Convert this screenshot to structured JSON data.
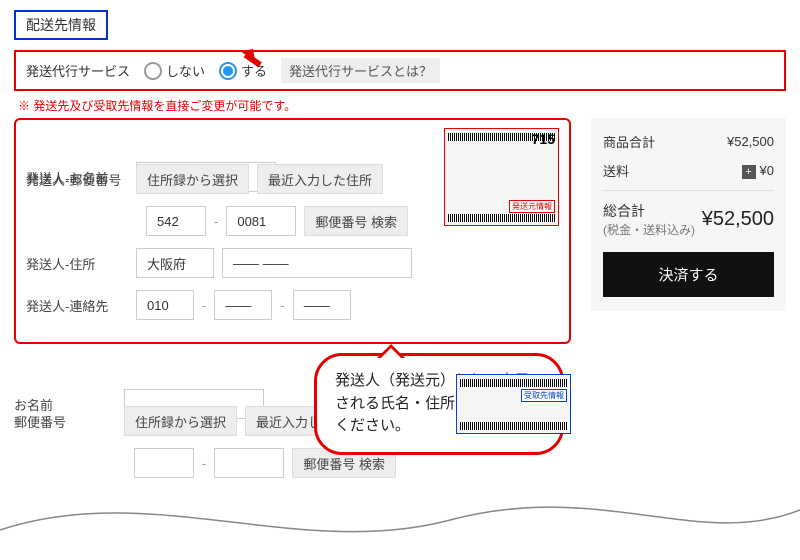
{
  "section_title": "配送先情報",
  "service": {
    "label": "発送代行サービス",
    "option_no": "しない",
    "option_yes": "する",
    "help": "発送代行サービスとは？",
    "selected": "yes"
  },
  "warn": "※ 発送先及び受取先情報を直接ご変更が可能です。",
  "sender": {
    "name_lbl": "発送人-お名前",
    "name_value": "— —",
    "post_lbl": "発送人-郵便番号",
    "btn_addrbook": "住所録から選択",
    "btn_recent": "最近入力した住所",
    "zip1": "542",
    "zip2": "0081",
    "btn_zip_search": "郵便番号 検索",
    "addr_lbl": "発送人-住所",
    "pref": "大阪府",
    "addr_rest": "——  ——",
    "tel_lbl": "発送人-連絡先",
    "tel1": "010",
    "tel2": "——",
    "tel3": "——"
  },
  "receiver": {
    "name_lbl": "お名前",
    "post_lbl": "郵便番号",
    "btn_addrbook": "住所録から選択",
    "btn_recent": "最近入力した住所",
    "btn_zip_search": "郵便番号 検索"
  },
  "slip": {
    "number": "715",
    "badge_sender": "発送元情報",
    "badge_receiver": "受取先情報"
  },
  "arrow_annotation": "arrow-to-radio",
  "bubble": "発送人（発送元）として表示される氏名・住所を入力してください。",
  "summary": {
    "subtotal_lbl": "商品合計",
    "subtotal_val": "¥52,500",
    "ship_lbl": "送料",
    "ship_val": "¥0",
    "plus": "+",
    "total_lbl": "総合計",
    "total_sub": "(税金・送料込み)",
    "total_val": "¥52,500",
    "cta": "決済する"
  }
}
